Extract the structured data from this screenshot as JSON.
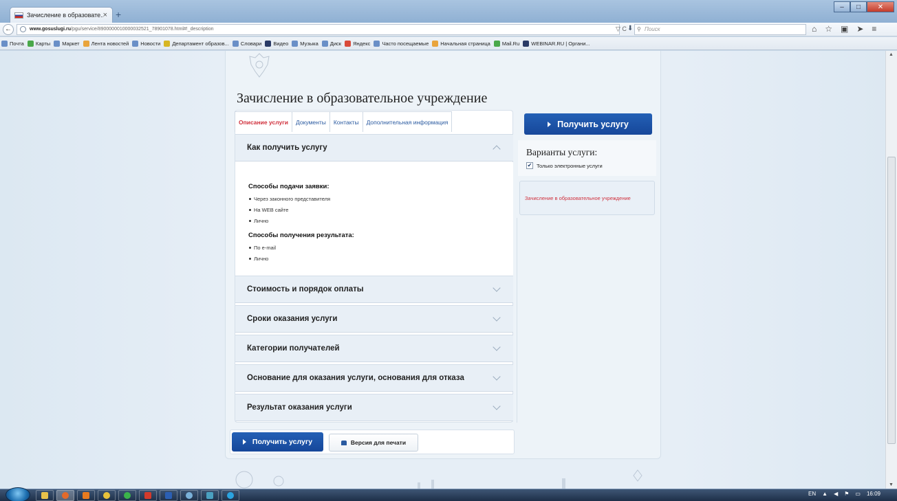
{
  "browser": {
    "tab_title": "Зачисление в образовате...",
    "tab_close": "×",
    "new_tab": "+",
    "url_host": "www.gosuslugi.ru",
    "url_path": "/pgu/service/8900000010000032521_78901078.html#!_description",
    "reload": "▽ C",
    "search_placeholder": "Поиск",
    "bookmarks": [
      {
        "label": "Почта",
        "color": "blue"
      },
      {
        "label": "Карты",
        "color": "green"
      },
      {
        "label": "Маркет",
        "color": "blue"
      },
      {
        "label": "Лента новостей",
        "color": "orange"
      },
      {
        "label": "Новости",
        "color": "blue"
      },
      {
        "label": "Департамент образов...",
        "color": "yellow"
      },
      {
        "label": "Словари",
        "color": "blue"
      },
      {
        "label": "Видео",
        "color": "dark"
      },
      {
        "label": "Музыка",
        "color": "blue"
      },
      {
        "label": "Диск",
        "color": "blue"
      },
      {
        "label": "Яндекс",
        "color": "red"
      },
      {
        "label": "Часто посещаемые",
        "color": "blue"
      },
      {
        "label": "Начальная страница",
        "color": "orange"
      },
      {
        "label": "Mail.Ru",
        "color": "green"
      },
      {
        "label": "WEBINAR.RU | Органи...",
        "color": "dark"
      }
    ]
  },
  "service": {
    "title": "Зачисление в образовательное учреждение",
    "tabs": [
      {
        "label": "Описание услуги",
        "active": true
      },
      {
        "label": "Документы",
        "active": false
      },
      {
        "label": "Контакты",
        "active": false
      },
      {
        "label": "Дополнительная информация",
        "active": false
      }
    ],
    "accordion_open": {
      "title": "Как получить услугу",
      "sections": [
        {
          "heading": "Способы подачи заявки:",
          "items": [
            "Через законного представителя",
            "На WEB сайте",
            "Лично"
          ]
        },
        {
          "heading": "Способы получения результата:",
          "items": [
            "По e-mail",
            "Лично"
          ]
        }
      ]
    },
    "accordion_closed": [
      "Стоимость и порядок оплаты",
      "Сроки оказания услуги",
      "Категории получателей",
      "Основание для оказания услуги, основания для отказа",
      "Результат оказания услуги"
    ],
    "get_service_label": "Получить услугу",
    "print_label": "Версия для печати",
    "variants": {
      "title": "Варианты услуги:",
      "checkbox_label": "Только электронные услуги",
      "checkbox_checked": true,
      "item": "Зачисление в образовательное учреждение"
    }
  },
  "taskbar": {
    "lang": "EN",
    "time": "16:09"
  },
  "colors": {
    "primary_button": "#1d54a8",
    "active_tab": "#d0303c",
    "link": "#2a5aa0"
  }
}
